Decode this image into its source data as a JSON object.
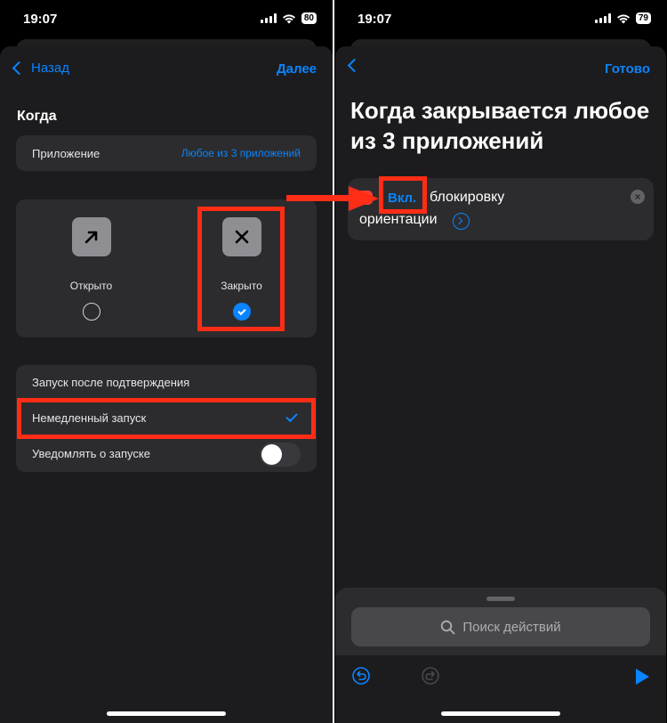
{
  "status_left": {
    "time": "19:07",
    "battery": "80"
  },
  "status_right": {
    "time": "19:07",
    "battery": "79"
  },
  "left": {
    "nav": {
      "back_label": "Назад",
      "next_label": "Далее"
    },
    "section_title": "Когда",
    "app_row": {
      "label": "Приложение",
      "value": "Любое из 3 приложений"
    },
    "options": [
      {
        "label": "Открыто",
        "selected": false,
        "icon": "arrow-up-right-icon"
      },
      {
        "label": "Закрыто",
        "selected": true,
        "icon": "close-x-icon"
      }
    ],
    "run_list": {
      "items": [
        {
          "label": "Запуск после подтверждения",
          "checked": false
        },
        {
          "label": "Немедленный запуск",
          "checked": true
        }
      ],
      "notify": {
        "label": "Уведомлять о запуске",
        "on": false
      }
    }
  },
  "right": {
    "nav": {
      "done_label": "Готово"
    },
    "title": "Когда закрывается любое из 3 приложений",
    "action": {
      "toggle_word": "Вкл.",
      "text_line1": "блокировку",
      "text_line2": "ориентации"
    },
    "search_placeholder": "Поиск действий"
  },
  "colors": {
    "accent": "#0a84ff",
    "highlight": "#ff2d16",
    "background": "#1c1c1e"
  }
}
